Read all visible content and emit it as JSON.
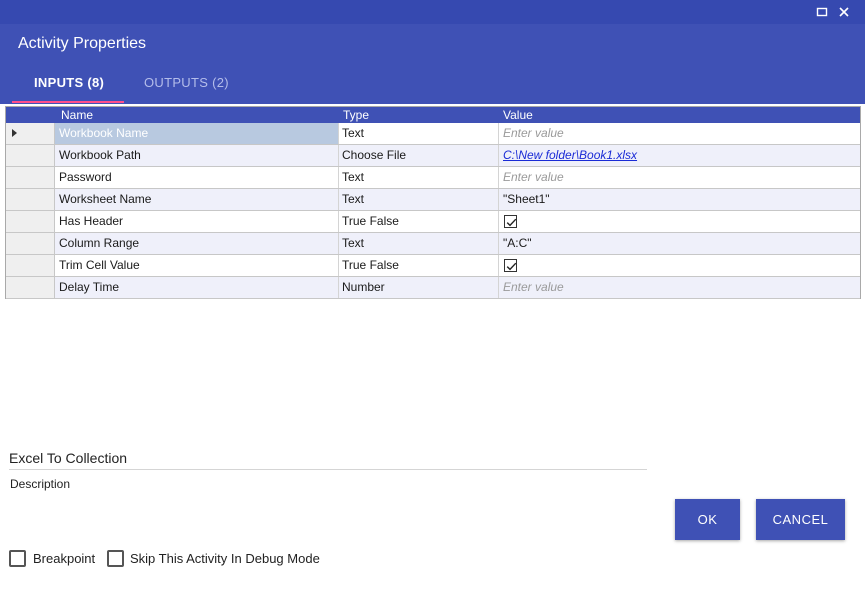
{
  "window": {
    "title": "Activity Properties",
    "maximize_icon": "maximize-icon",
    "close_icon": "close-icon"
  },
  "tabs": [
    {
      "label": "INPUTS (8)",
      "active": true
    },
    {
      "label": "OUTPUTS (2)",
      "active": false
    }
  ],
  "grid": {
    "columns": {
      "name": "Name",
      "type": "Type",
      "value": "Value"
    },
    "rows": [
      {
        "name": "Workbook Name",
        "type": "Text",
        "value": "Enter value",
        "value_kind": "placeholder",
        "selected": true
      },
      {
        "name": "Workbook Path",
        "type": "Choose File",
        "value": "C:\\New folder\\Book1.xlsx",
        "value_kind": "link"
      },
      {
        "name": "Password",
        "type": "Text",
        "value": "Enter value",
        "value_kind": "placeholder"
      },
      {
        "name": "Worksheet Name",
        "type": "Text",
        "value": "\"Sheet1\"",
        "value_kind": "text"
      },
      {
        "name": "Has Header",
        "type": "True False",
        "value": true,
        "value_kind": "checkbox"
      },
      {
        "name": "Column Range",
        "type": "Text",
        "value": "\"A:C\"",
        "value_kind": "text"
      },
      {
        "name": "Trim Cell Value",
        "type": "True False",
        "value": true,
        "value_kind": "checkbox"
      },
      {
        "name": "Delay Time",
        "type": "Number",
        "value": "Enter value",
        "value_kind": "placeholder"
      }
    ]
  },
  "activity": {
    "name": "Excel To Collection",
    "description_label": "Description"
  },
  "buttons": {
    "ok": "OK",
    "cancel": "CANCEL"
  },
  "options": {
    "breakpoint": {
      "label": "Breakpoint",
      "checked": false
    },
    "skip_debug": {
      "label": "Skip This Activity In Debug Mode",
      "checked": false
    }
  },
  "colors": {
    "title_bar": "#3649b0",
    "header": "#3f51b5",
    "tab_indicator": "#ff4f8b",
    "selected_cell": "#b8c9e0",
    "alt_row": "#eff0fa"
  }
}
